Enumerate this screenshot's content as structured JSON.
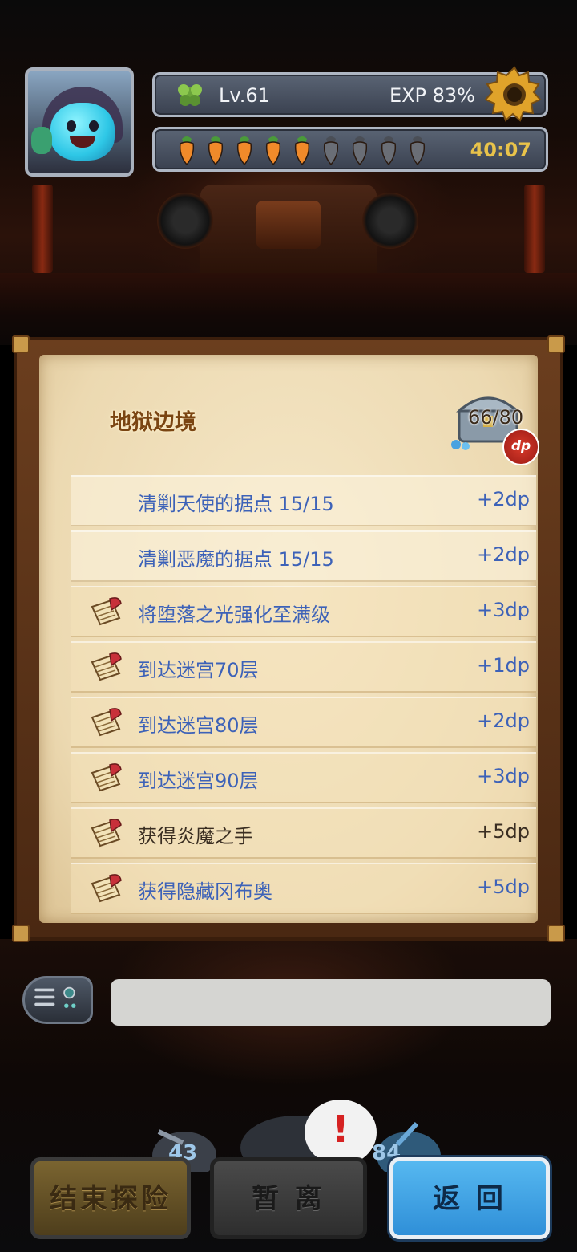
{
  "hud": {
    "level": "Lv.61",
    "exp": "EXP 83%",
    "timer": "40:07",
    "stamina": {
      "filled": 5,
      "total": 9
    },
    "colors": {
      "timer": "#e9c34a",
      "carrot": "#f08a2a",
      "carrot_empty": "#6a6e76"
    }
  },
  "panel": {
    "title": "地狱边境",
    "dp_count": "66/80",
    "dp_badge": "dp",
    "rows": [
      {
        "label": "清剿天使的据点 15/15",
        "points": "+2dp",
        "icon": "none",
        "style": "light"
      },
      {
        "label": "清剿恶魔的据点 15/15",
        "points": "+2dp",
        "icon": "none",
        "style": "light"
      },
      {
        "label": "将堕落之光强化至满级",
        "points": "+3dp",
        "icon": "scroll-quill-icon",
        "style": "normal"
      },
      {
        "label": "到达迷宫70层",
        "points": "+1dp",
        "icon": "scroll-quill-icon",
        "style": "normal"
      },
      {
        "label": "到达迷宫80层",
        "points": "+2dp",
        "icon": "scroll-quill-icon",
        "style": "normal"
      },
      {
        "label": "到达迷宫90层",
        "points": "+3dp",
        "icon": "scroll-quill-icon",
        "style": "normal"
      },
      {
        "label": "获得炎魔之手",
        "points": "+5dp",
        "icon": "scroll-quill-icon",
        "style": "dark"
      },
      {
        "label": "获得隐藏冈布奥",
        "points": "+5dp",
        "icon": "scroll-quill-icon",
        "style": "normal"
      }
    ]
  },
  "chat": {
    "value": ""
  },
  "bottom": {
    "badge_left": "43",
    "badge_right": "84",
    "alert": "!",
    "buttons": {
      "end": "结束探险",
      "pause": "暂 离",
      "back": "返 回"
    }
  }
}
